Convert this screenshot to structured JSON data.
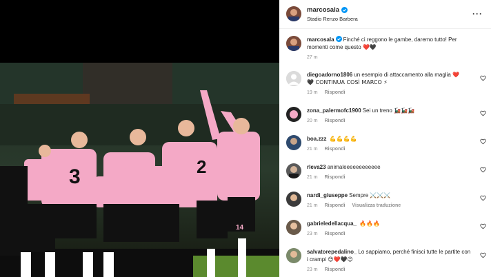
{
  "post": {
    "author": "marcosala",
    "location": "Stadio Renzo Barbera",
    "more_icon": "more-horizontal-icon"
  },
  "caption": {
    "user": "marcosala",
    "text": "Finché ci reggono le gambe, daremo tutto! Per momenti come questo",
    "emoji": "❤️🖤",
    "time": "27 m"
  },
  "comments": [
    {
      "user": "diegoadorno1806",
      "text": "un esempio di attaccamento alla maglia",
      "emoji_inline": "❤️",
      "line2": "🖤 CONTINUA COSÌ MARCO ⚡",
      "time": "19 m",
      "reply": "Rispondi"
    },
    {
      "user": "zona_palermofc1900",
      "text": "Sei un treno",
      "emoji": "🚂🚂🚂",
      "time": "20 m",
      "reply": "Rispondi"
    },
    {
      "user": "boa.zzz",
      "text": "",
      "emoji": "💪💪💪💪",
      "time": "21 m",
      "reply": "Rispondi"
    },
    {
      "user": "rleva23",
      "text": "animaleeeeeeeeeeee",
      "emoji": "",
      "time": "21 m",
      "reply": "Rispondi"
    },
    {
      "user": "nardi_giuseppe",
      "text": "Sempre",
      "emoji": "⚔️⚔️⚔️",
      "time": "21 m",
      "reply": "Rispondi",
      "translate": "Visualizza traduzione"
    },
    {
      "user": "gabrieledellacqua_",
      "text": "",
      "emoji": "🔥🔥🔥",
      "time": "23 m",
      "reply": "Rispondi"
    },
    {
      "user": "salvatorepedalino_",
      "text": "Lo sappiamo, perché finisci tutte le partite con i crampi",
      "emoji": "😍❤️🖤😉",
      "time": "23 m",
      "reply": "Rispondi"
    }
  ],
  "colors": {
    "pink_jersey": "#f4a9c6",
    "verified_blue": "#0095f6",
    "meta_gray": "#8e8e8e",
    "text": "#262626"
  }
}
